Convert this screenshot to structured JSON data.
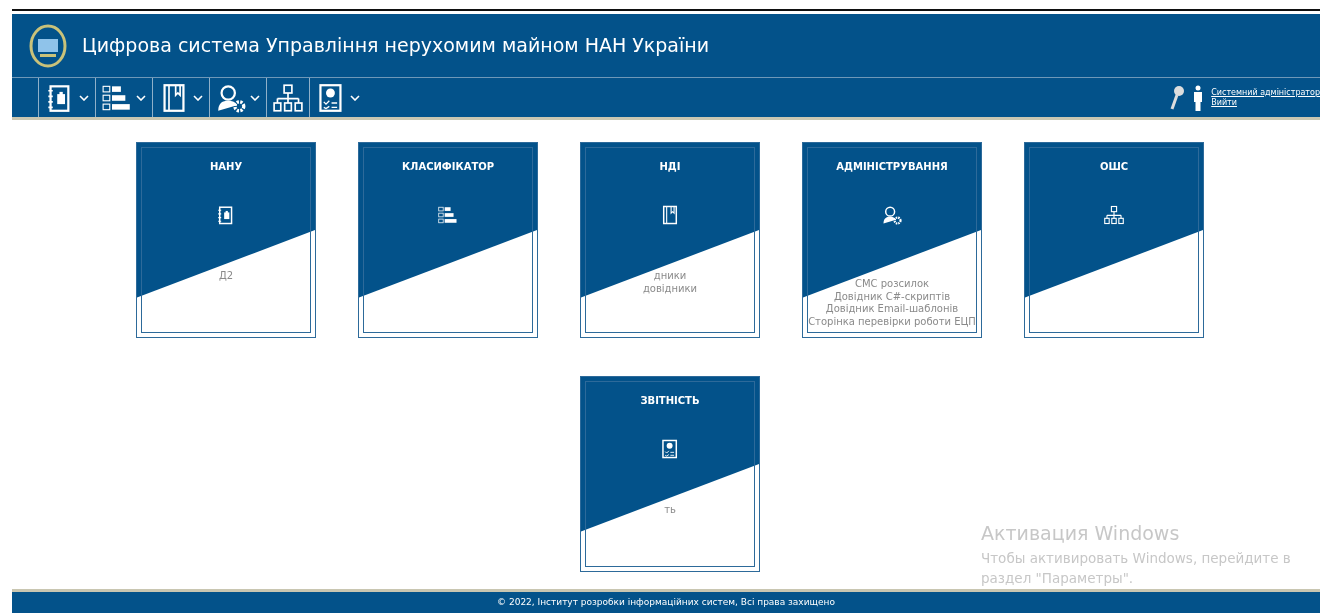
{
  "header": {
    "title": "Цифрова система Управління нерухомим майном НАН України"
  },
  "toolbar": [
    {
      "kind": "clipboard",
      "dropdown": true
    },
    {
      "kind": "list",
      "dropdown": true
    },
    {
      "kind": "book",
      "dropdown": true
    },
    {
      "kind": "admin",
      "dropdown": true
    },
    {
      "kind": "hierarchy",
      "dropdown": false
    },
    {
      "kind": "report",
      "dropdown": true
    }
  ],
  "user": {
    "name": "Системний адміністратор",
    "logout": "Вийти"
  },
  "tiles": [
    {
      "title": "НАНУ",
      "kind": "clipboard",
      "items": [
        "Д2"
      ]
    },
    {
      "title": "КЛАСИФІКАТОР",
      "kind": "list"
    },
    {
      "title": "НДІ",
      "kind": "book",
      "items": [
        "дники",
        "довідники"
      ]
    },
    {
      "title": "АДМІНІСТРУВАННЯ",
      "kind": "admin",
      "items": [
        "СМС розсилок",
        "Довідник C#-скриптів",
        "Довідник Email-шаблонів",
        "Сторінка перевірки роботи ЕЦП"
      ]
    },
    {
      "title": "ОШС",
      "kind": "hierarchy"
    },
    {
      "title": "ЗВІТНІСТЬ",
      "kind": "report",
      "items": [
        "ть"
      ]
    }
  ],
  "activation": {
    "title": "Активация Windows",
    "text": "Чтобы активировать Windows, перейдите в раздел \"Параметры\"."
  },
  "footer": "© 2022, Інститут розробки інформаційних систем, Всі права захищено"
}
